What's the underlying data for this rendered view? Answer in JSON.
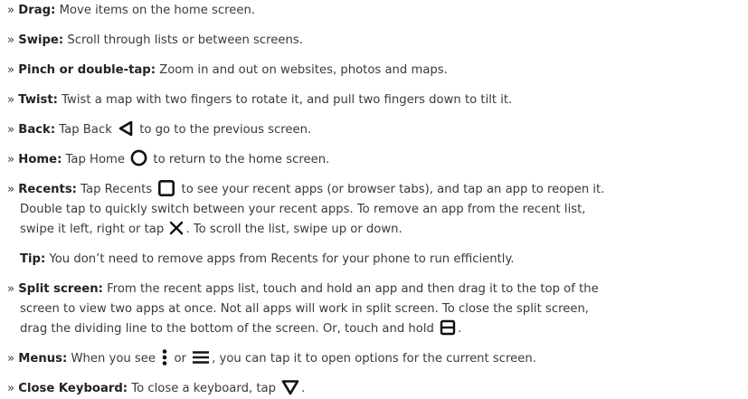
{
  "bullet": "»",
  "items": [
    {
      "term": "Drag:",
      "text": "Move items on the home screen."
    },
    {
      "term": "Swipe:",
      "text": "Scroll through lists or between screens."
    },
    {
      "term": "Pinch or double-tap:",
      "text": "Zoom in and out on websites, photos and maps."
    },
    {
      "term": "Twist:",
      "text": "Twist a map with two fingers to rotate it, and pull two fingers down to tilt it."
    },
    {
      "term": "Back:",
      "text_a": "Tap Back",
      "icon": "back-triangle-icon",
      "text_b": "to go to the previous screen."
    },
    {
      "term": "Home:",
      "text_a": "Tap Home",
      "icon": "home-circle-icon",
      "text_b": "to return to the home screen."
    },
    {
      "term": "Recents:",
      "text_a": "Tap Recents",
      "icon": "recents-square-icon",
      "text_b": "to see your recent apps (or browser tabs), and tap an app to reopen it.",
      "line2": "Double tap to quickly switch between your recent apps. To remove an app from the recent list,",
      "line3_a": "swipe it left, right or tap",
      "icon2": "close-x-icon",
      "line3_b": ". To scroll the list, swipe up or down."
    },
    {
      "term": "Tip:",
      "text": "You don’t need to remove apps from Recents for your phone to run efficiently."
    },
    {
      "term": "Split screen:",
      "text": "From the recent apps list, touch and hold an app and then drag it to the top of the",
      "line2": "screen to view two apps at once. Not all apps will work in split screen. To close the split screen,",
      "line3_a": "drag the dividing line to the bottom of the screen. Or, touch and hold",
      "icon": "split-screen-icon",
      "line3_b": "."
    },
    {
      "term": "Menus:",
      "text_a": "When you see",
      "icon": "more-vertical-icon",
      "text_mid": "or",
      "icon2": "menu-icon",
      "text_b": ", you can tap it to open options for the current screen."
    },
    {
      "term": "Close Keyboard:",
      "text_a": "To close a keyboard, tap",
      "icon": "down-triangle-icon",
      "text_b": "."
    }
  ]
}
